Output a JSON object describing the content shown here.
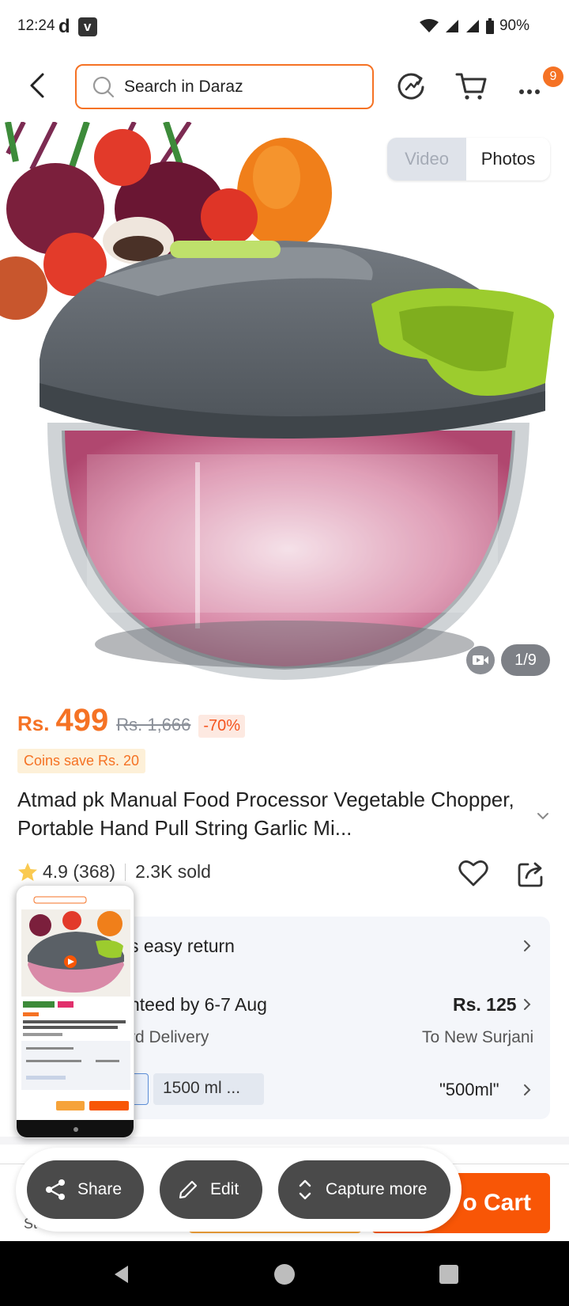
{
  "status_bar": {
    "time": "12:24",
    "app_icon_1": "d",
    "app_icon_2": "v",
    "battery": "90%"
  },
  "header": {
    "search_placeholder": "Search in Daraz",
    "cart_badge": "9"
  },
  "media": {
    "video_label": "Video",
    "photos_label": "Photos",
    "counter": "1/9"
  },
  "price": {
    "currency": "Rs.",
    "value": "499",
    "original": "Rs. 1,666",
    "discount": "-70%",
    "coins": "Coins save Rs. 20"
  },
  "product": {
    "title": "Atmad pk Manual Food Processor Vegetable Chopper, Portable Hand Pull String Garlic Mi...",
    "rating": "4.9 (368)",
    "sold": "2.3K sold"
  },
  "service": {
    "return_text": "s easy return",
    "delivery_text": "nteed by 6-7 Aug",
    "delivery_type": "rd Delivery",
    "delivery_fee": "Rs. 125",
    "delivery_location": "To New Surjani",
    "variant_a": "l",
    "variant_b": "1500 ml ...",
    "variant_selected": "\"500ml\""
  },
  "bottom": {
    "add_to_cart": "o Cart",
    "store_partial": "St"
  },
  "screenshot_actions": {
    "share": "Share",
    "edit": "Edit",
    "capture_more": "Capture more"
  },
  "colors": {
    "accent": "#f57224",
    "cart_button": "#f85606",
    "buy_now": "#f6a33a"
  }
}
